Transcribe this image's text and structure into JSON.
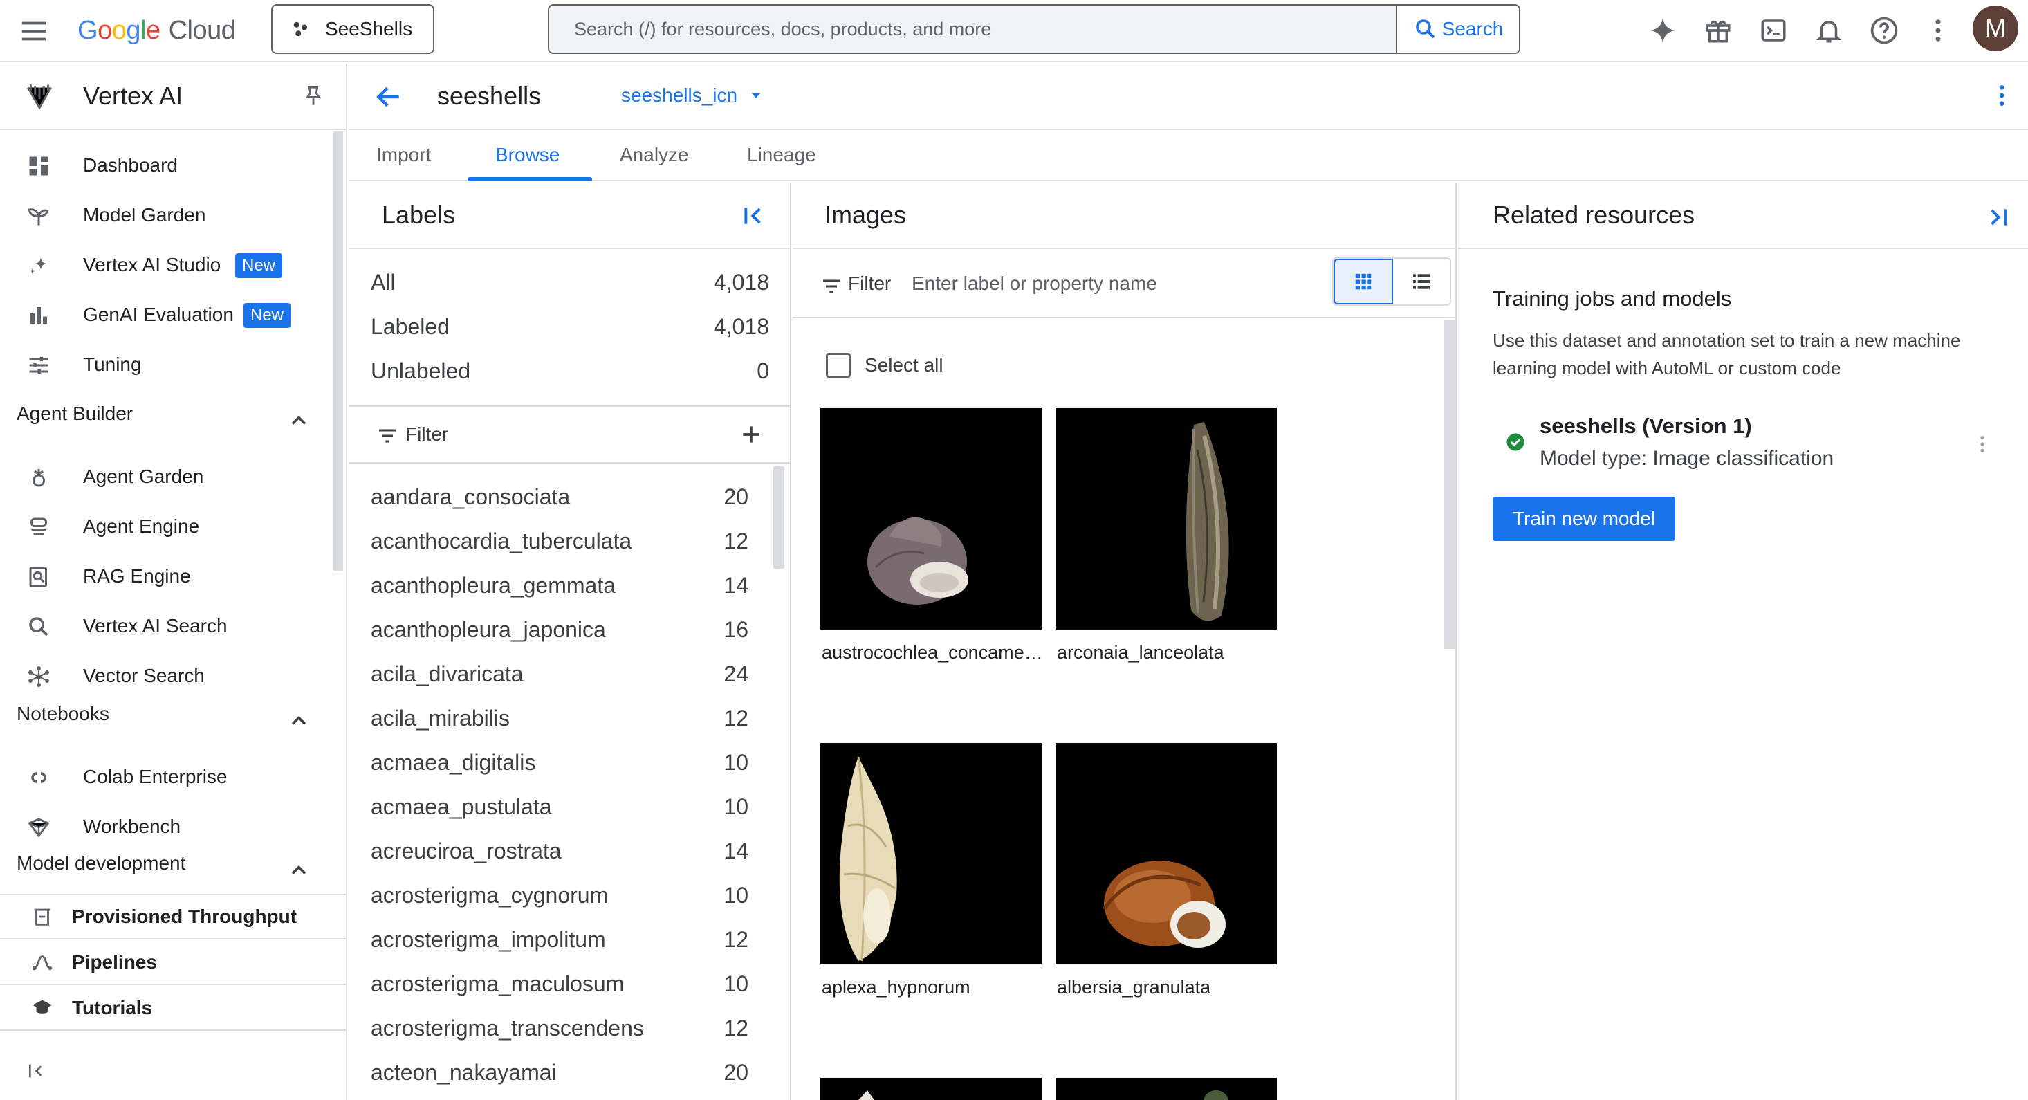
{
  "header": {
    "logo_google": [
      "G",
      "o",
      "o",
      "g",
      "l",
      "e"
    ],
    "logo_product": "Cloud",
    "project": "SeeShells",
    "search_placeholder": "Search (/) for resources, docs, products, and more",
    "search_button": "Search",
    "avatar_initial": "M"
  },
  "sidebar": {
    "title": "Vertex AI",
    "items_top": [
      {
        "label": "Dashboard",
        "icon": "dashboard-icon"
      },
      {
        "label": "Model Garden",
        "icon": "model-garden-icon"
      },
      {
        "label": "Vertex AI Studio",
        "icon": "sparkle-icon",
        "badge": "New"
      },
      {
        "label": "GenAI Evaluation",
        "icon": "bar-chart-icon",
        "badge": "New"
      },
      {
        "label": "Tuning",
        "icon": "tune-icon"
      }
    ],
    "section_agent": "Agent Builder",
    "items_agent": [
      {
        "label": "Agent Garden",
        "icon": "agent-garden-icon"
      },
      {
        "label": "Agent Engine",
        "icon": "agent-engine-icon"
      },
      {
        "label": "RAG Engine",
        "icon": "rag-engine-icon"
      },
      {
        "label": "Vertex AI Search",
        "icon": "search-icon"
      },
      {
        "label": "Vector Search",
        "icon": "vector-search-icon"
      }
    ],
    "section_notebooks": "Notebooks",
    "items_notebooks": [
      {
        "label": "Colab Enterprise",
        "icon": "colab-icon"
      },
      {
        "label": "Workbench",
        "icon": "workbench-icon"
      }
    ],
    "section_model_dev": "Model development",
    "items_model_dev": [
      {
        "label": "Provisioned Throughput",
        "icon": "throughput-icon"
      },
      {
        "label": "Pipelines",
        "icon": "pipelines-icon"
      },
      {
        "label": "Tutorials",
        "icon": "tutorials-icon"
      }
    ]
  },
  "content": {
    "dataset_name": "seeshells",
    "annotation_set": "seeshells_icn",
    "tabs": [
      "Import",
      "Browse",
      "Analyze",
      "Lineage"
    ],
    "active_tab": "Browse"
  },
  "labels_panel": {
    "title": "Labels",
    "summary": [
      {
        "label": "All",
        "count": "4,018"
      },
      {
        "label": "Labeled",
        "count": "4,018"
      },
      {
        "label": "Unlabeled",
        "count": "0"
      }
    ],
    "filter_label": "Filter",
    "labels": [
      {
        "name": "aandara_consociata",
        "count": "20"
      },
      {
        "name": "acanthocardia_tuberculata",
        "count": "12"
      },
      {
        "name": "acanthopleura_gemmata",
        "count": "14"
      },
      {
        "name": "acanthopleura_japonica",
        "count": "16"
      },
      {
        "name": "acila_divaricata",
        "count": "24"
      },
      {
        "name": "acila_mirabilis",
        "count": "12"
      },
      {
        "name": "acmaea_digitalis",
        "count": "10"
      },
      {
        "name": "acmaea_pustulata",
        "count": "10"
      },
      {
        "name": "acreuciroa_rostrata",
        "count": "14"
      },
      {
        "name": "acrosterigma_cygnorum",
        "count": "10"
      },
      {
        "name": "acrosterigma_impolitum",
        "count": "12"
      },
      {
        "name": "acrosterigma_maculosum",
        "count": "10"
      },
      {
        "name": "acrosterigma_transcendens",
        "count": "12"
      },
      {
        "name": "acteon_nakayamai",
        "count": "20"
      }
    ]
  },
  "images_panel": {
    "title": "Images",
    "filter_label": "Filter",
    "filter_placeholder": "Enter label or property name",
    "select_all": "Select all",
    "images": [
      {
        "caption": "austrocochlea_concamerata"
      },
      {
        "caption": "arconaia_lanceolata"
      },
      {
        "caption": "aplexa_hypnorum"
      },
      {
        "caption": "albersia_granulata"
      }
    ]
  },
  "related_panel": {
    "title": "Related resources",
    "subtitle": "Training jobs and models",
    "description": "Use this dataset and annotation set to train a new machine learning model with AutoML or custom code",
    "model_name": "seeshells (Version 1)",
    "model_type": "Model type: Image classification",
    "train_button": "Train new model"
  },
  "colors": {
    "accent": "#1a73e8",
    "border": "#dadce0",
    "success": "#1e8e3e"
  }
}
